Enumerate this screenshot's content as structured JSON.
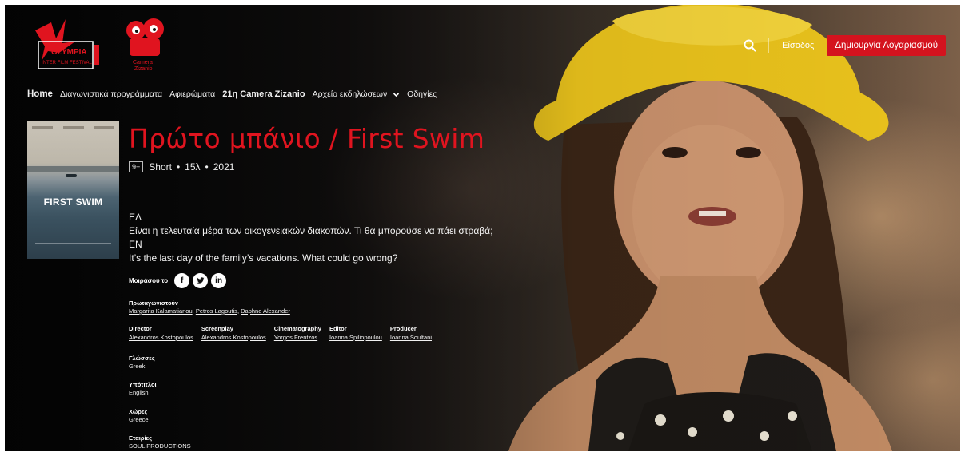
{
  "header": {
    "logo_festival": "Olympia International Film Festival",
    "logo_camera": "Camera Zizanio",
    "login_label": "Είσοδος",
    "signup_label": "Δημιουργία Λογαριασμού"
  },
  "nav": {
    "items": [
      {
        "label": "Home"
      },
      {
        "label": "Διαγωνιστικά προγράμματα"
      },
      {
        "label": "Αφιερώματα"
      },
      {
        "label": "21η Camera Zizanio"
      },
      {
        "label": "Αρχείο εκδηλώσεων"
      },
      {
        "label": "Οδηγίες"
      }
    ]
  },
  "poster": {
    "title": "FIRST SWIM"
  },
  "film": {
    "title": "Πρώτο μπάνιο / First Swim",
    "rating": "9+",
    "type": "Short",
    "duration": "15λ",
    "year": "2021",
    "synopsis": {
      "el_label": "ΕΛ",
      "el_text": "Είναι η τελευταία μέρα των οικογενειακών διακοπών. Τι θα μπορούσε να πάει στραβά;",
      "en_label": "EN",
      "en_text": "It’s the last day of the family’s vacations. What could go wrong?"
    }
  },
  "share": {
    "label": "Μοιράσου το",
    "icons": [
      "facebook-icon",
      "twitter-icon",
      "linkedin-icon"
    ]
  },
  "cast": {
    "heading": "Πρωταγωνιστούν",
    "names": [
      "Margarita Kalamatianou",
      "Petros Lagoutis",
      "Daphne Alexander"
    ]
  },
  "crew": [
    {
      "role": "Director",
      "name": "Alexandros Kostopoulos"
    },
    {
      "role": "Screenplay",
      "name": "Alexandros Kostopoulos"
    },
    {
      "role": "Cinematography",
      "name": "Yorgos Frentzos"
    },
    {
      "role": "Editor",
      "name": "Ioanna Spiliopoulou"
    },
    {
      "role": "Producer",
      "name": "Ioanna Soultani"
    }
  ],
  "details": {
    "languages_heading": "Γλώσσες",
    "languages": "Greek",
    "subtitles_heading": "Υπότιτλοι",
    "subtitles": "English",
    "countries_heading": "Χώρες",
    "countries": "Greece",
    "companies_heading": "Εταιρίες",
    "companies": "SOUL PRODUCTIONS"
  },
  "colors": {
    "accent": "#e0141f",
    "button": "#d4131e",
    "hat": "#e9c21c"
  }
}
